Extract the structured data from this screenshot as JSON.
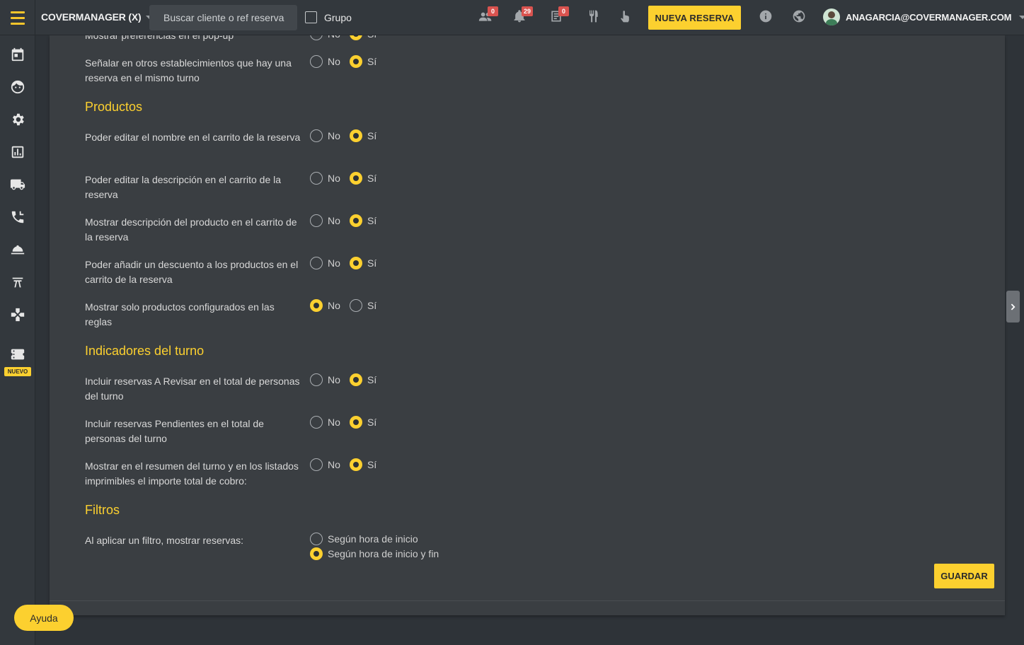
{
  "topbar": {
    "brand": "COVERMANAGER (X)",
    "search_placeholder": "Buscar cliente o ref reserva",
    "group_label": "Grupo",
    "badges": {
      "groups": "0",
      "notifications": "29",
      "tasks": "0"
    },
    "new_reservation_label": "NUEVA RESERVA",
    "user_email": "ANAGARCIA@COVERMANAGER.COM"
  },
  "sidebar": {
    "new_badge": "NUEVO",
    "items": [
      "calendar-icon",
      "client-face-icon",
      "gear-icon",
      "stats-icon",
      "delivery-truck-icon",
      "phone-icon",
      "cloche-icon",
      "table-icon",
      "gamepad-icon",
      "ticket-icon"
    ]
  },
  "options": {
    "no": "No",
    "yes": "Sí"
  },
  "settings": {
    "partial_row": {
      "label": "Mostrar preferencias en el pop-up",
      "value": "yes"
    },
    "rows_top": [
      {
        "label": "Señalar en otros establecimientos que hay una reserva en el mismo turno",
        "value": "yes"
      }
    ],
    "sections": [
      {
        "title": "Productos",
        "rows": [
          {
            "label": "Poder editar el nombre en el carrito de la reserva",
            "value": "yes"
          },
          {
            "label": "Poder editar la descripción en el carrito de la reserva",
            "value": "yes"
          },
          {
            "label": "Mostrar descripción del producto en el carrito de la reserva",
            "value": "yes"
          },
          {
            "label": "Poder añadir un descuento a los productos en el carrito de la reserva",
            "value": "yes"
          },
          {
            "label": "Mostrar solo productos configurados en las reglas",
            "value": "no"
          }
        ]
      },
      {
        "title": "Indicadores del turno",
        "rows": [
          {
            "label": "Incluir reservas A Revisar en el total de personas del turno",
            "value": "yes"
          },
          {
            "label": "Incluir reservas Pendientes en el total de personas del turno",
            "value": "yes"
          },
          {
            "label": "Mostrar en el resumen del turno y en los listados imprimibles el importe total de cobro:",
            "value": "yes"
          }
        ]
      },
      {
        "title": "Filtros",
        "filter_row": {
          "label": "Al aplicar un filtro, mostrar reservas:",
          "options": [
            "Según hora de inicio",
            "Según hora de inicio y fin"
          ],
          "selected": "Según hora de inicio y fin"
        }
      }
    ]
  },
  "save_label": "GUARDAR",
  "help_label": "Ayuda",
  "colors": {
    "accent": "#fcd02f",
    "panel": "#3a3e42",
    "background": "#2e3338"
  }
}
